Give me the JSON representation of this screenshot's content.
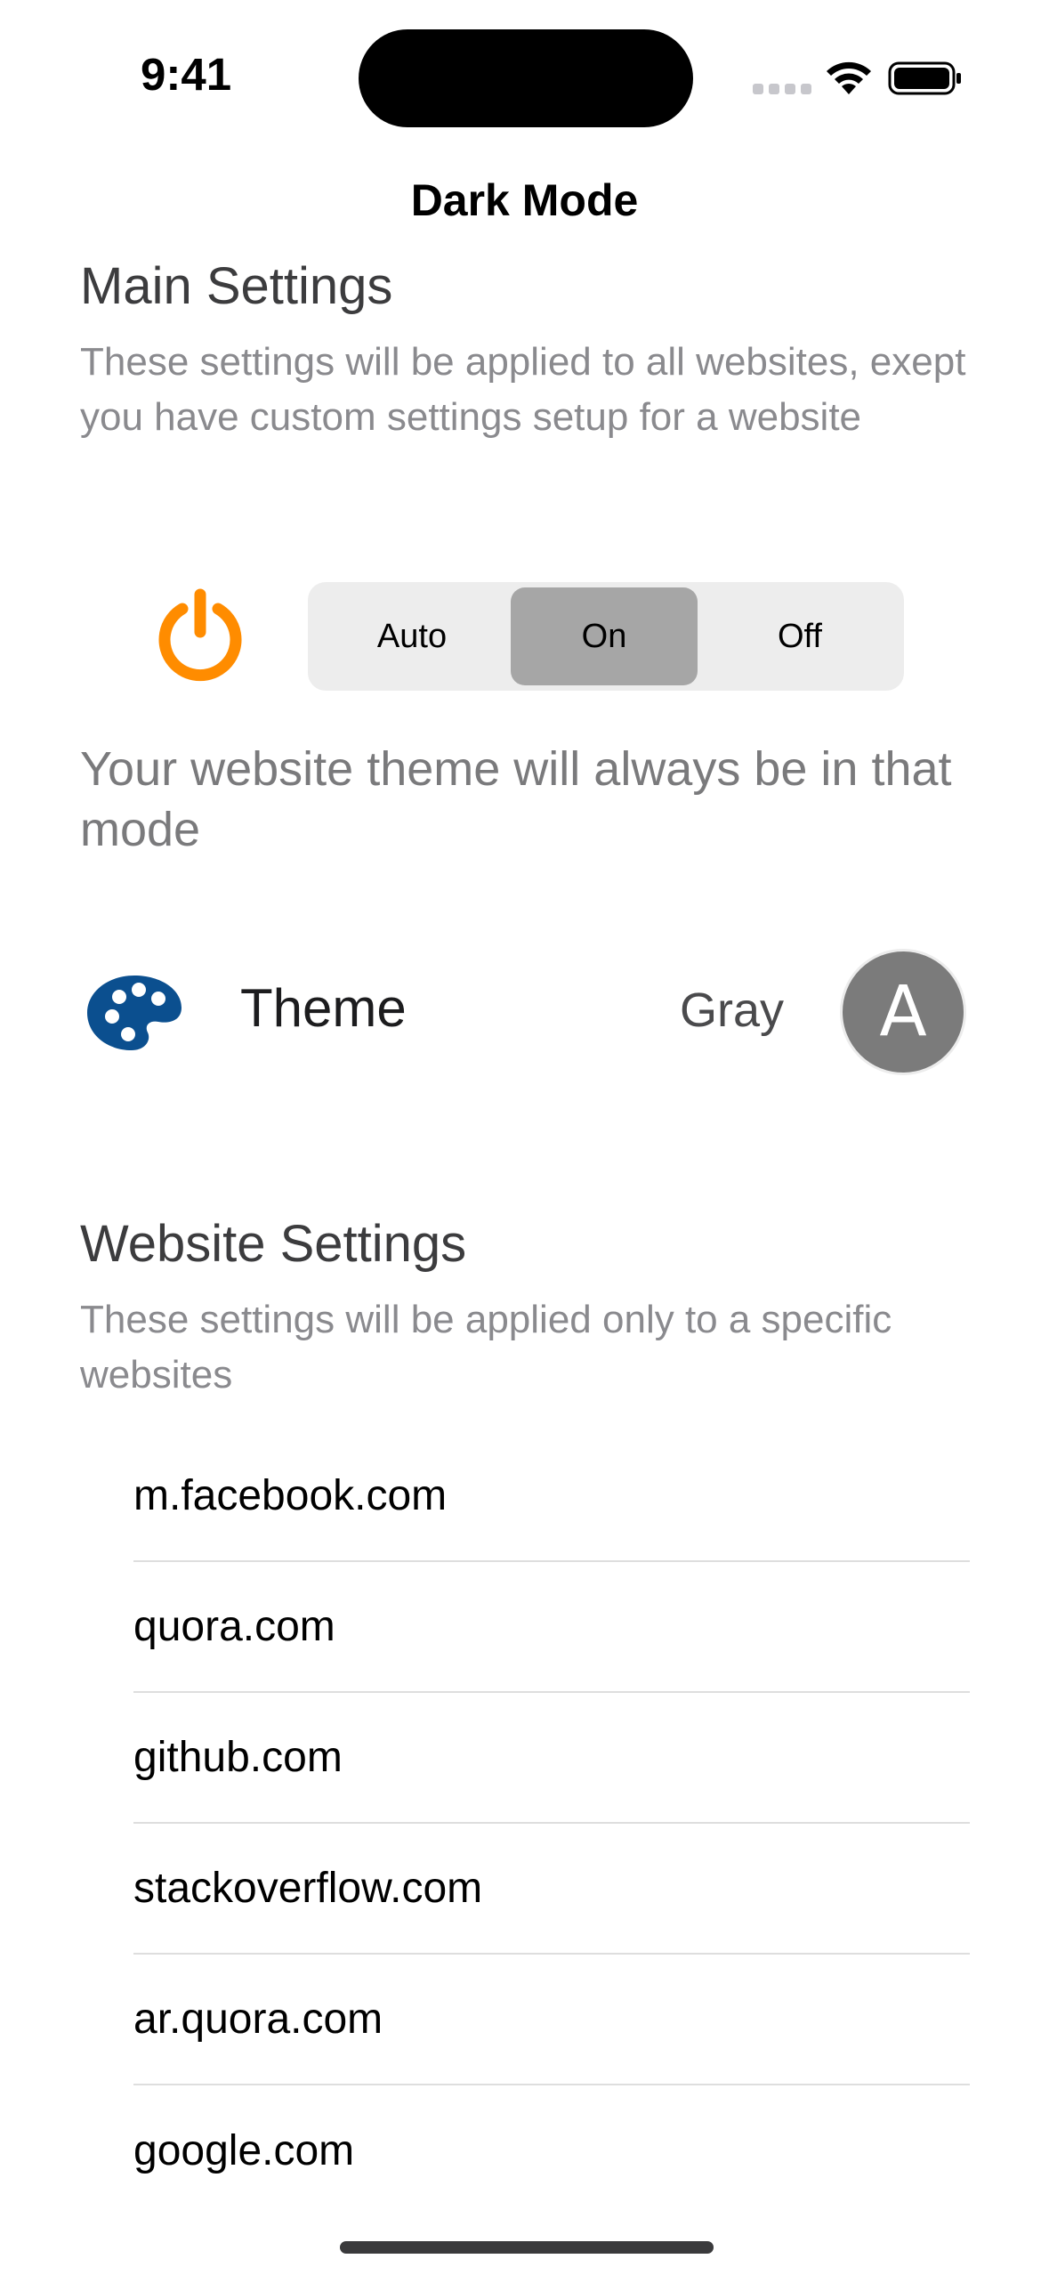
{
  "status_bar": {
    "time": "9:41"
  },
  "nav": {
    "title": "Dark Mode"
  },
  "main_settings": {
    "heading": "Main Settings",
    "description": "These settings will be applied to all websites, exept you have custom settings setup for a website",
    "power_icon": "power-icon",
    "power_icon_color": "#FF8C00",
    "segments": [
      "Auto",
      "On",
      "Off"
    ],
    "selected_segment": "On",
    "mode_description": "Your website theme will always be in that mode"
  },
  "theme": {
    "icon": "palette-icon",
    "icon_color": "#0B4F8F",
    "label": "Theme",
    "value": "Gray",
    "avatar_letter": "A",
    "avatar_color": "#7B7B7B"
  },
  "website_settings": {
    "heading": "Website Settings",
    "description": "These settings will be applied only to a specific websites",
    "sites": [
      "m.facebook.com",
      "quora.com",
      "github.com",
      "stackoverflow.com",
      "ar.quora.com",
      "google.com"
    ]
  }
}
